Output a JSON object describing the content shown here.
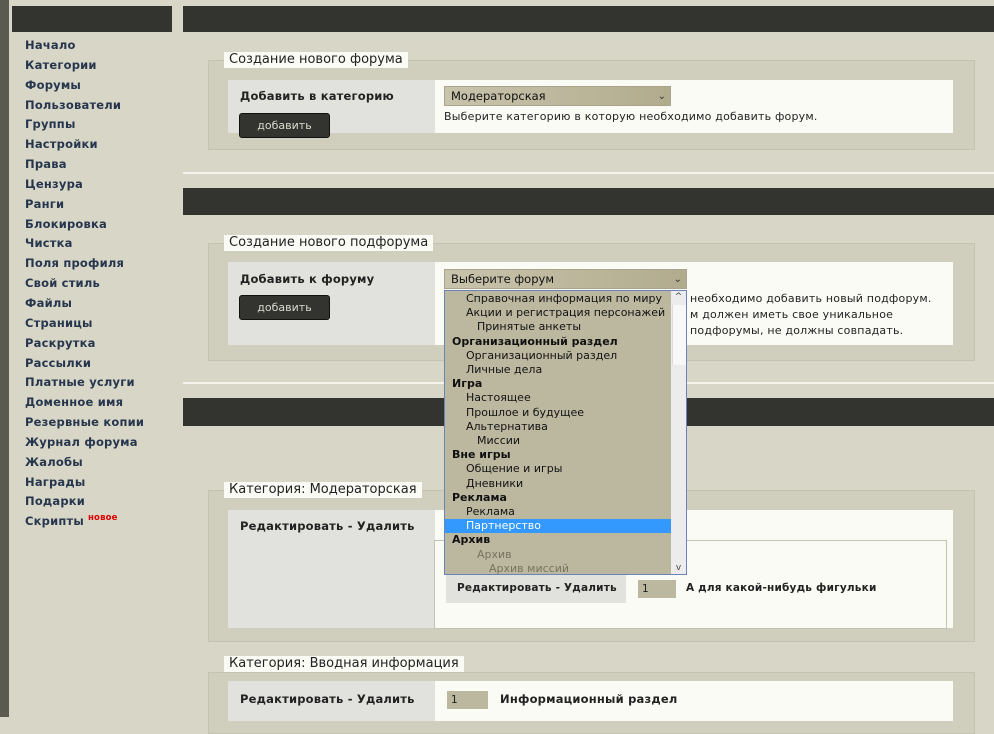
{
  "sidebar": {
    "items": [
      "Начало",
      "Категории",
      "Форумы",
      "Пользователи",
      "Группы",
      "Настройки",
      "Права",
      "Цензура",
      "Ранги",
      "Блокировка",
      "Чистка",
      "Поля профиля",
      "Свой стиль",
      "Файлы",
      "Страницы",
      "Раскрутка",
      "Рассылки",
      "Платные услуги",
      "Доменное имя",
      "Резервные копии",
      "Журнал форума",
      "Жалобы",
      "Награды",
      "Подарки",
      "Скрипты"
    ],
    "new_badge": "новое"
  },
  "new_forum": {
    "legend": "Создание нового форума",
    "label": "Добавить в категорию",
    "button": "добавить",
    "select_value": "Модераторская",
    "hint": "Выберите категорию в которую необходимо добавить форум."
  },
  "new_subforum": {
    "legend": "Создание нового подфорума",
    "label": "Добавить к форуму",
    "button": "добавить",
    "select_value": "Выберите форум",
    "hint_line1": "необходимо добавить новый подфорум.",
    "hint_line2": "м должен иметь свое уникальное",
    "hint_line3": "подфорумы, не должны совпадать."
  },
  "dropdown": {
    "options": [
      {
        "text": "Справочная информация по миру",
        "level": 1,
        "type": "opt"
      },
      {
        "text": "Акции и регистрация персонажей",
        "level": 1,
        "type": "opt"
      },
      {
        "text": "Принятые анкеты",
        "level": 2,
        "type": "opt"
      },
      {
        "text": "Организационный раздел",
        "level": 0,
        "type": "group"
      },
      {
        "text": "Организационный раздел",
        "level": 1,
        "type": "opt"
      },
      {
        "text": "Личные дела",
        "level": 1,
        "type": "opt"
      },
      {
        "text": "Игра",
        "level": 0,
        "type": "group"
      },
      {
        "text": "Настоящее",
        "level": 1,
        "type": "opt"
      },
      {
        "text": "Прошлое и будущее",
        "level": 1,
        "type": "opt"
      },
      {
        "text": "Альтернатива",
        "level": 1,
        "type": "opt"
      },
      {
        "text": "Миссии",
        "level": 2,
        "type": "opt"
      },
      {
        "text": "Вне игры",
        "level": 0,
        "type": "group"
      },
      {
        "text": "Общение и игры",
        "level": 1,
        "type": "opt"
      },
      {
        "text": "Дневники",
        "level": 1,
        "type": "opt"
      },
      {
        "text": "Реклама",
        "level": 0,
        "type": "group"
      },
      {
        "text": "Реклама",
        "level": 1,
        "type": "opt"
      },
      {
        "text": "Партнерство",
        "level": 1,
        "type": "sel"
      },
      {
        "text": "Архив",
        "level": 0,
        "type": "group"
      },
      {
        "text": "Архив",
        "level": 2,
        "type": "dis"
      },
      {
        "text": "Архив миссий",
        "level": 3,
        "type": "dis"
      }
    ],
    "scroll_up": "^",
    "scroll_down": "v"
  },
  "category_mod": {
    "legend": "Категория: Модераторская",
    "edit_delete": "Редактировать - Удалить",
    "sub_edit_delete": "Редактировать - Удалить",
    "sub_position": "1",
    "sub_forum_name": "А для какой-нибудь фигульки"
  },
  "category_intro": {
    "legend": "Категория: Вводная информация",
    "edit_delete": "Редактировать - Удалить",
    "position": "1",
    "forum_name": "Информационный раздел"
  },
  "icons": {
    "select_arrow": "chevron-down-icon"
  }
}
